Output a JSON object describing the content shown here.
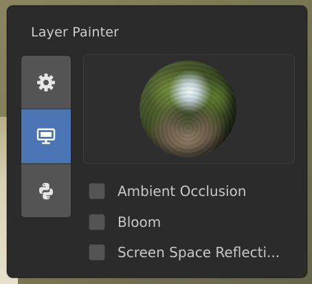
{
  "panel": {
    "title": "Layer Painter"
  },
  "tabs": [
    {
      "icon": "gear-icon",
      "active": false
    },
    {
      "icon": "monitor-icon",
      "active": true
    },
    {
      "icon": "python-icon",
      "active": false
    }
  ],
  "colors": {
    "panel_bg": "#2b2b2b",
    "tab_bg": "#545454",
    "tab_active": "#4a74b4",
    "text": "#c8c8c8"
  },
  "options": [
    {
      "label": "Ambient Occlusion",
      "checked": false
    },
    {
      "label": "Bloom",
      "checked": false
    },
    {
      "label": "Screen Space Reflecti...",
      "checked": false
    }
  ]
}
